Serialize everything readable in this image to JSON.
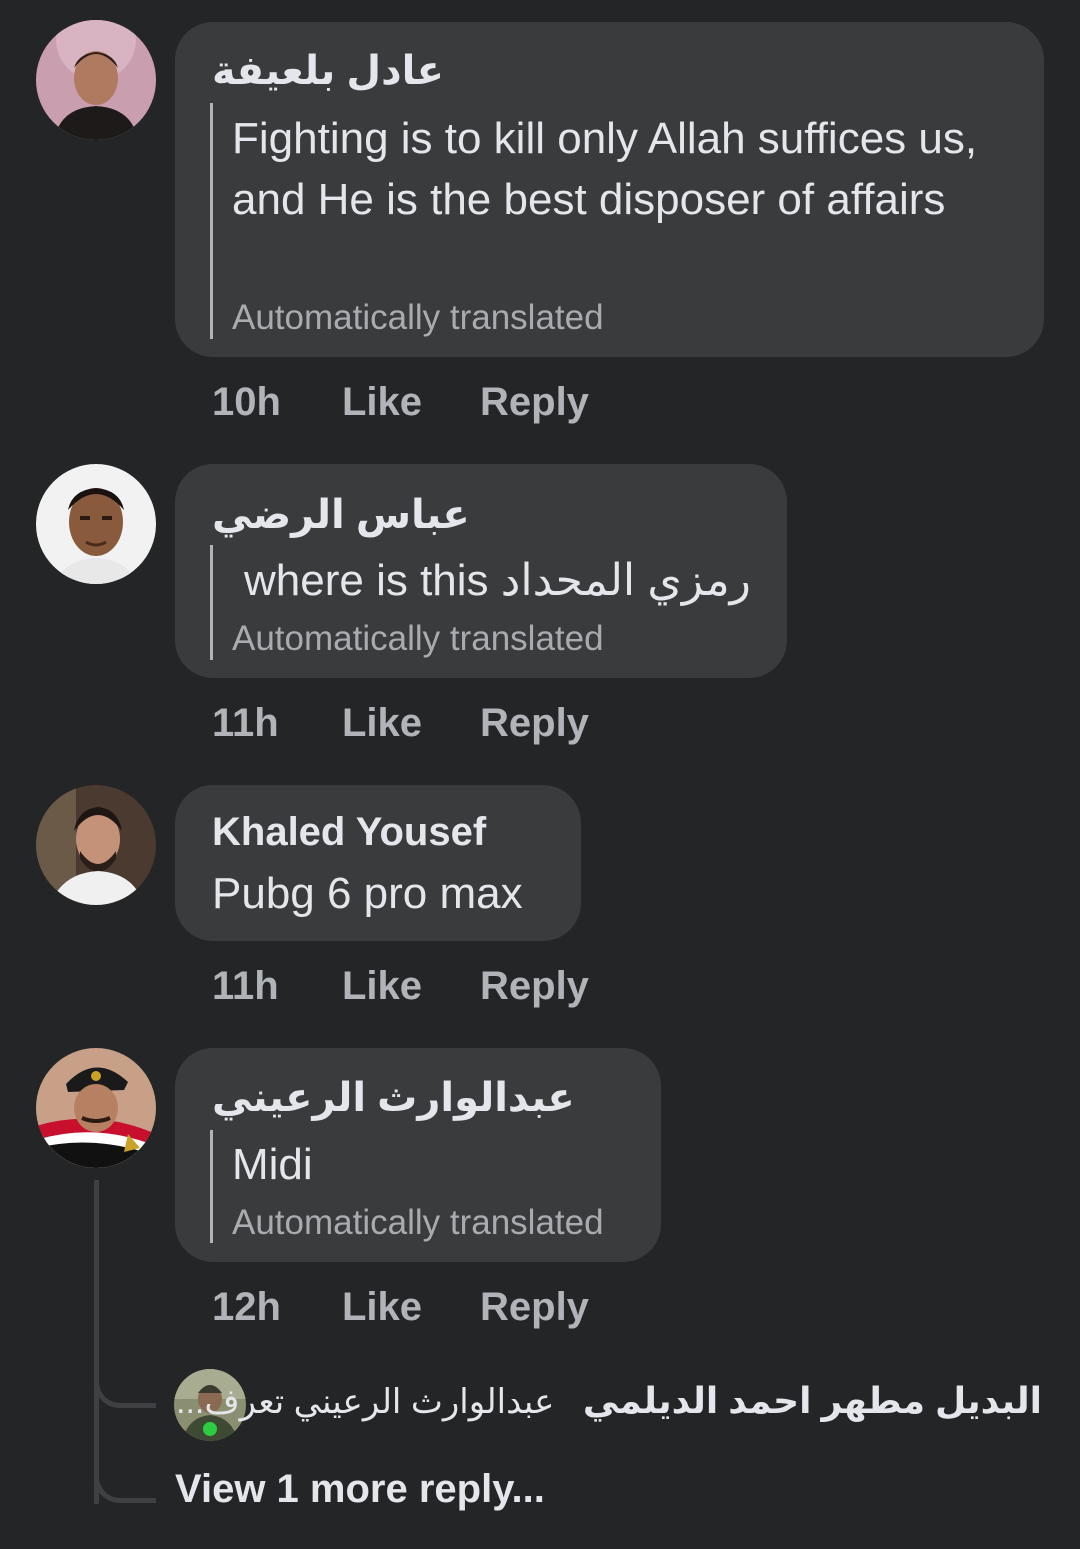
{
  "comments": [
    {
      "author": "عادل بلعيفة",
      "text": "Fighting is to kill only Allah suffices us, and He is the best disposer of affairs",
      "translated_label": "Automatically translated",
      "time": "10h",
      "like_label": "Like",
      "reply_label": "Reply"
    },
    {
      "author": "عباس الرضي",
      "text": "where is this رمزي المحداد",
      "translated_label": "Automatically translated",
      "time": "11h",
      "like_label": "Like",
      "reply_label": "Reply"
    },
    {
      "author": "Khaled Yousef",
      "text": "Pubg 6 pro max",
      "time": "11h",
      "like_label": "Like",
      "reply_label": "Reply"
    },
    {
      "author": "عبدالوارث الرعيني",
      "text": "Midi",
      "translated_label": "Automatically translated",
      "time": "12h",
      "like_label": "Like",
      "reply_label": "Reply"
    }
  ],
  "reply_preview": {
    "author": "البديل مطهر احمد الديلمي",
    "text": "عبدالوارث الرعيني تعرف..."
  },
  "view_more_label": "View 1 more reply...",
  "colors": {
    "background": "#242526",
    "bubble": "#3a3b3c",
    "primary_text": "#e4e6eb",
    "secondary_text": "#b0b3b8"
  }
}
